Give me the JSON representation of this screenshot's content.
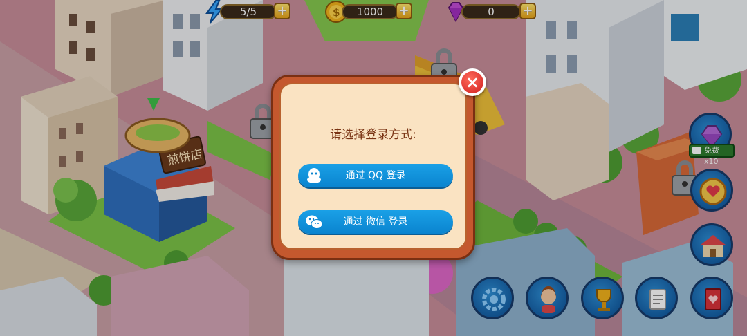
{
  "hud": {
    "energy": "5/5",
    "coins": "1000",
    "gems": "0",
    "plus": "+"
  },
  "shop_sign": "煎饼店",
  "dialog": {
    "title": "请选择登录方式:",
    "qq_login_label": "通过 QQ 登录",
    "wechat_login_label": "通过 微信 登录",
    "close": "×"
  },
  "free_video_badge": "免费x10",
  "colors": {
    "button_blue": "#0a84cf",
    "dialog_frame": "#c4582e",
    "dialog_bg": "#fae3c2",
    "title_text": "#7a3414",
    "close_red": "#d01f1f"
  },
  "icons": [
    "lightning-icon",
    "coin-icon",
    "gem-icon",
    "qq-icon",
    "wechat-icon",
    "close-icon",
    "settings-gear-icon",
    "customer-avatar-icon",
    "trophy-icon",
    "notepad-icon",
    "recipe-book-icon",
    "shop-icon",
    "heart-target-icon",
    "gem-chest-icon",
    "padlock-icon"
  ]
}
